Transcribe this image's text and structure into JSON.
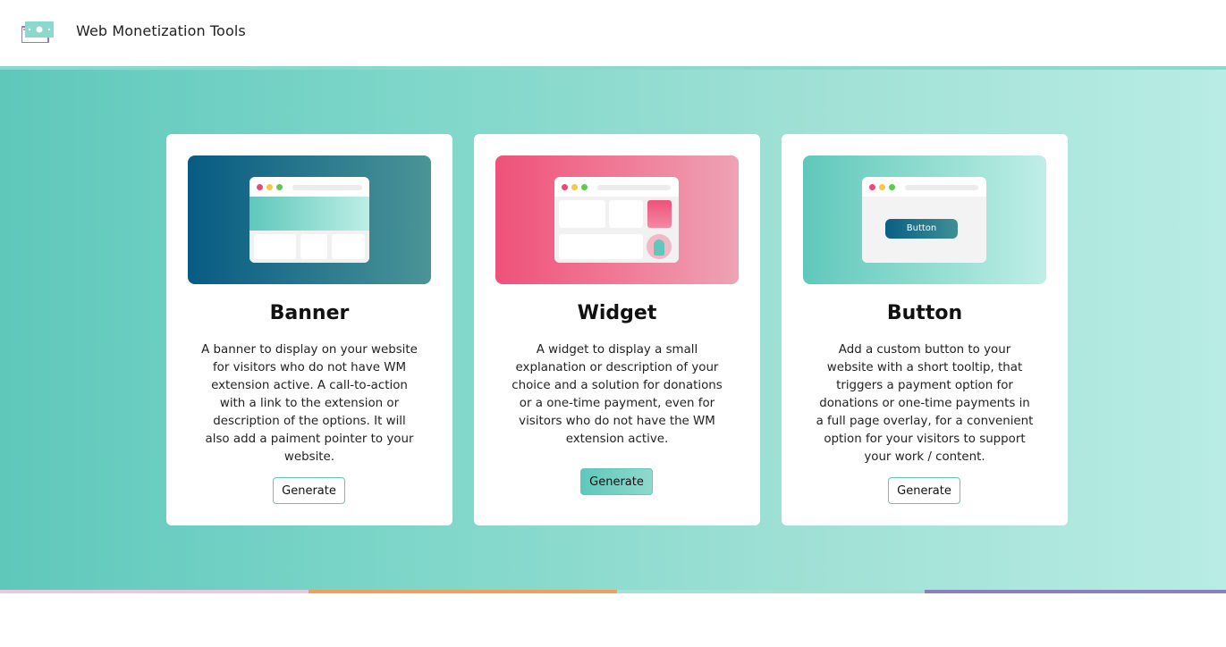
{
  "header": {
    "app_title": "Web Monetization Tools",
    "logo_icon": "money-bill-icon"
  },
  "colors": {
    "accent": "#5fc8bb",
    "banner_gradient_start": "#075b83",
    "widget_gradient_start": "#ef5179",
    "footer_segments": [
      "#ebc9dd",
      "#f0a05c",
      "#a5e0d7",
      "#8b7fbf"
    ]
  },
  "cards": [
    {
      "title": "Banner",
      "description": "A banner to display on your website for visitors who do not have WM extension active. A call-to-action with a link to the extension or description of the options. It will also add a paiment pointer to your website.",
      "button_label": "Generate"
    },
    {
      "title": "Widget",
      "description": "A widget to display a small explanation or description of your choice and a solution for donations or a one-time payment, even for visitors who do not have the WM extension active.",
      "button_label": "Generate"
    },
    {
      "title": "Button",
      "description": "Add a custom button to your website with a short tooltip, that triggers a payment option for donations or one-time payments in a full page overlay, for a convenient option for your visitors to support your work / content.",
      "button_label": "Generate",
      "preview_button_label": "Button"
    }
  ]
}
